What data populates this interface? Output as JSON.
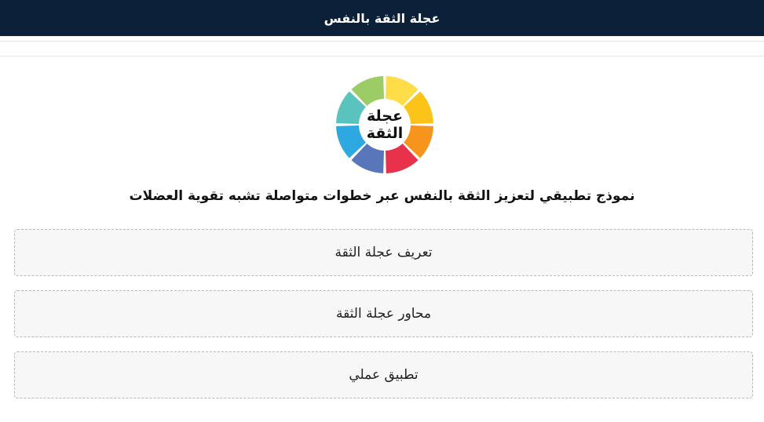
{
  "header": {
    "title": "عجلة الثقة بالنفس"
  },
  "logo": {
    "line1": "عجلة",
    "line2": "الثقة",
    "segment_colors": [
      "#fedd48",
      "#fcc419",
      "#f7941d",
      "#e8314a",
      "#5a76bb",
      "#2ea8e0",
      "#5bc3bd",
      "#9ccc65"
    ]
  },
  "main": {
    "subtitle": "نموذج تطبيقي لتعزيز الثقة بالنفس عبر خطوات متواصلة تشبه تقوية العضلات",
    "buttons": [
      {
        "label": "تعريف عجلة الثقة"
      },
      {
        "label": "محاور عجلة الثقة"
      },
      {
        "label": "تطبيق عملي"
      }
    ]
  }
}
